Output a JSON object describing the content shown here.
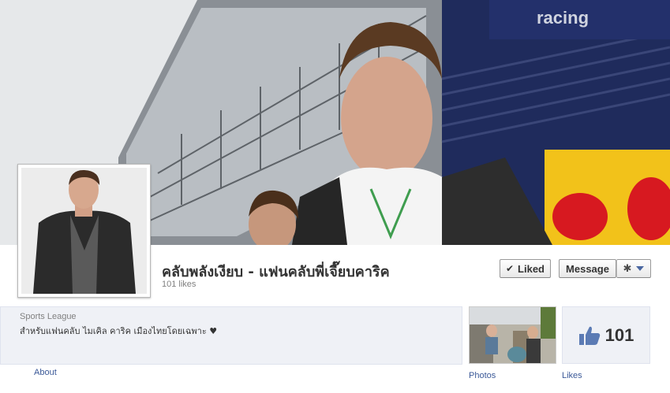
{
  "cover": {
    "description_icon": "cover-photo"
  },
  "page": {
    "name": "คลับพลังเงียบ - แฟนคลับพี่เจี๊ยบคาริค",
    "likes_text": "101 likes"
  },
  "actions": {
    "liked_label": "Liked",
    "message_label": "Message"
  },
  "info": {
    "category": "Sports League",
    "description": "สำหรับแฟนคลับ ไมเคิล คาริค เมืองไทยโดยเฉพาะ ♥",
    "about_label": "About"
  },
  "tiles": {
    "photos_label": "Photos",
    "likes_count": "101",
    "likes_label": "Likes"
  },
  "colors": {
    "link": "#3b5998",
    "panel": "#eff1f6",
    "redbull_navy": "#1c2a6e",
    "redbull_yellow": "#f5c518",
    "redbull_red": "#d71920"
  }
}
